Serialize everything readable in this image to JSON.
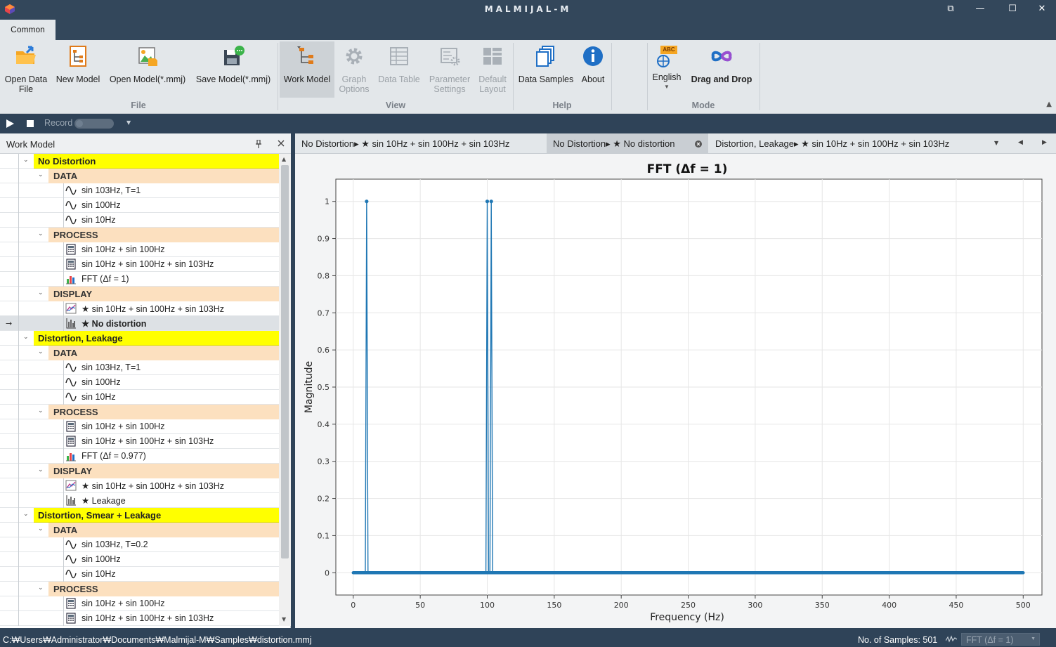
{
  "window": {
    "title": "MALMIJAL-M",
    "controls": [
      "⧉",
      "—",
      "☐",
      "✕"
    ]
  },
  "ribbon_tabs": [
    {
      "label": "Common"
    }
  ],
  "ribbon": {
    "file": {
      "group_label": "File",
      "buttons": [
        {
          "label1": "Open Data",
          "label2": "File",
          "icon": "open-folder-icon"
        },
        {
          "label1": "New Model",
          "label2": "",
          "icon": "new-model-icon"
        },
        {
          "label1": "Open Model(*.mmj)",
          "label2": "",
          "icon": "open-model-icon"
        },
        {
          "label1": "Save Model(*.mmj)",
          "label2": "",
          "icon": "save-model-icon"
        }
      ]
    },
    "view": {
      "group_label": "View",
      "buttons": [
        {
          "label1": "Work Model",
          "label2": "",
          "icon": "work-model-icon"
        },
        {
          "label1": "Graph",
          "label2": "Options",
          "icon": "gear-icon"
        },
        {
          "label1": "Data Table",
          "label2": "",
          "icon": "table-icon"
        },
        {
          "label1": "Parameter",
          "label2": "Settings",
          "icon": "parameter-settings-icon"
        },
        {
          "label1": "Default",
          "label2": "Layout",
          "icon": "layout-icon"
        }
      ]
    },
    "help": {
      "group_label": "Help",
      "buttons": [
        {
          "label1": "Data Samples",
          "label2": "",
          "icon": "data-samples-icon"
        },
        {
          "label1": "About",
          "label2": "",
          "icon": "info-icon"
        }
      ]
    },
    "mode": {
      "group_label": "Mode",
      "buttons": [
        {
          "label1": "English",
          "label2": "",
          "icon": "language-icon",
          "badge": "ABC"
        },
        {
          "label1": "Drag and Drop",
          "label2": "",
          "icon": "drag-drop-icon"
        }
      ]
    }
  },
  "toolbar": {
    "record_label": "Record"
  },
  "work_model": {
    "title": "Work Model",
    "rows": [
      {
        "type": "group",
        "label": "No Distortion"
      },
      {
        "type": "sect",
        "label": "DATA"
      },
      {
        "type": "item",
        "icon": "wave",
        "label": "sin 103Hz, T=1"
      },
      {
        "type": "item",
        "icon": "wave",
        "label": "sin 100Hz"
      },
      {
        "type": "item",
        "icon": "wave",
        "label": "sin 10Hz"
      },
      {
        "type": "sect",
        "label": "PROCESS"
      },
      {
        "type": "item",
        "icon": "calc",
        "label": "sin 10Hz + sin 100Hz"
      },
      {
        "type": "item",
        "icon": "calc",
        "label": "sin 10Hz + sin 100Hz + sin 103Hz"
      },
      {
        "type": "item",
        "icon": "fft",
        "label": "FFT (Δf = 1)"
      },
      {
        "type": "sect",
        "label": "DISPLAY"
      },
      {
        "type": "item",
        "icon": "linechart",
        "label": "★ sin 10Hz + sin 100Hz + sin 103Hz"
      },
      {
        "type": "item",
        "icon": "barchart",
        "label": "★ No distortion",
        "selected": true
      },
      {
        "type": "group",
        "label": "Distortion, Leakage"
      },
      {
        "type": "sect",
        "label": "DATA"
      },
      {
        "type": "item",
        "icon": "wave",
        "label": "sin 103Hz, T=1"
      },
      {
        "type": "item",
        "icon": "wave",
        "label": "sin 100Hz"
      },
      {
        "type": "item",
        "icon": "wave",
        "label": "sin 10Hz"
      },
      {
        "type": "sect",
        "label": "PROCESS"
      },
      {
        "type": "item",
        "icon": "calc",
        "label": "sin 10Hz + sin 100Hz"
      },
      {
        "type": "item",
        "icon": "calc",
        "label": "sin 10Hz + sin 100Hz + sin 103Hz"
      },
      {
        "type": "item",
        "icon": "fft",
        "label": "FFT (Δf = 0.977)"
      },
      {
        "type": "sect",
        "label": "DISPLAY"
      },
      {
        "type": "item",
        "icon": "linechart",
        "label": "★ sin 10Hz + sin 100Hz + sin 103Hz"
      },
      {
        "type": "item",
        "icon": "barchart",
        "label": "★ Leakage"
      },
      {
        "type": "group",
        "label": "Distortion, Smear + Leakage"
      },
      {
        "type": "sect",
        "label": "DATA"
      },
      {
        "type": "item",
        "icon": "wave",
        "label": "sin 103Hz, T=0.2"
      },
      {
        "type": "item",
        "icon": "wave",
        "label": "sin 100Hz"
      },
      {
        "type": "item",
        "icon": "wave",
        "label": "sin 10Hz"
      },
      {
        "type": "sect",
        "label": "PROCESS"
      },
      {
        "type": "item",
        "icon": "calc",
        "label": "sin 10Hz + sin 100Hz"
      },
      {
        "type": "item",
        "icon": "calc",
        "label": "sin 10Hz + sin 100Hz + sin 103Hz"
      }
    ]
  },
  "doc_tabs": [
    {
      "label": "No Distortion▸ ★ sin 10Hz + sin 100Hz + sin 103Hz",
      "active": false
    },
    {
      "label": "No Distortion▸ ★ No distortion",
      "active": true
    },
    {
      "label": "Distortion, Leakage▸ ★ sin 10Hz + sin 100Hz + sin 103Hz",
      "active": false
    }
  ],
  "chart_data": {
    "type": "line",
    "title": "FFT (Δf = 1)",
    "xlabel": "Frequency (Hz)",
    "ylabel": "Magnitude",
    "xlim": [
      -13,
      514
    ],
    "ylim": [
      -0.06,
      1.06
    ],
    "xticks": [
      0,
      50,
      100,
      150,
      200,
      250,
      300,
      350,
      400,
      450,
      500
    ],
    "yticks": [
      0,
      0.1,
      0.2,
      0.3,
      0.4,
      0.5,
      0.6,
      0.7,
      0.8,
      0.9,
      1
    ],
    "grid": true,
    "series": [
      {
        "color": "#1f77b4",
        "x_range": [
          0,
          500
        ],
        "step": 1,
        "baseline": 0,
        "peaks": [
          {
            "x": 10,
            "y": 1
          },
          {
            "x": 100,
            "y": 1
          },
          {
            "x": 103,
            "y": 1
          }
        ]
      }
    ]
  },
  "status": {
    "path": "C:₩Users₩Administrator₩Documents₩Malmijal-M₩Samples₩distortion.mmj",
    "samples": "No. of Samples: 501",
    "selector": "FFT (Δf = 1)"
  }
}
